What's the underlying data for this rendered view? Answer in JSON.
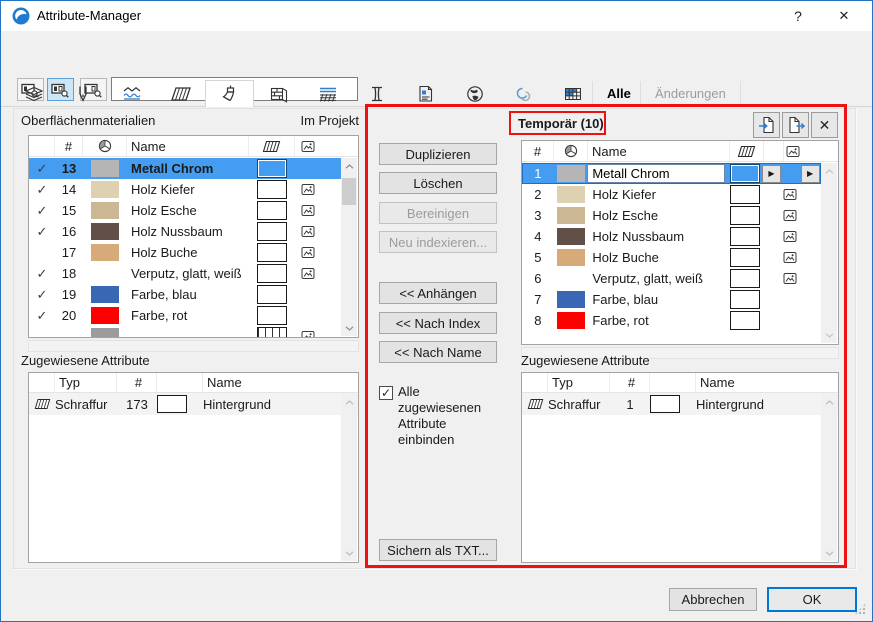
{
  "glyphs": {
    "check": "✓",
    "arrow_right": "▶",
    "close": "✕",
    "help": "?"
  },
  "window": {
    "title": "Attribute-Manager"
  },
  "toolbar": {
    "search_value": ""
  },
  "tab_bar": {
    "alle": "Alle",
    "aenderungen": "Änderungen"
  },
  "headers": {
    "index": "#",
    "name": "Name",
    "type": "Typ"
  },
  "left_panel": {
    "title": "Oberflächenmaterialien",
    "scope": "Im Projekt",
    "rows": [
      {
        "checked": true,
        "index": "13",
        "color": "#b5b5b5",
        "name": "Metall Chrom",
        "has_image": false,
        "selected": true
      },
      {
        "checked": true,
        "index": "14",
        "color": "#ddd1b2",
        "name": "Holz Kiefer",
        "has_image": true,
        "selected": false
      },
      {
        "checked": true,
        "index": "15",
        "color": "#ccb794",
        "name": "Holz Esche",
        "has_image": true,
        "selected": false
      },
      {
        "checked": true,
        "index": "16",
        "color": "#625048",
        "name": "Holz Nussbaum",
        "has_image": true,
        "selected": false
      },
      {
        "checked": false,
        "index": "17",
        "color": "#d7aa79",
        "name": "Holz Buche",
        "has_image": true,
        "selected": false
      },
      {
        "checked": true,
        "index": "18",
        "color": "",
        "name": "Verputz, glatt, weiß",
        "has_image": true,
        "selected": false
      },
      {
        "checked": true,
        "index": "19",
        "color": "#3a67b4",
        "name": "Farbe, blau",
        "has_image": false,
        "selected": false
      },
      {
        "checked": true,
        "index": "20",
        "color": "#fb0200",
        "name": "Farbe, rot",
        "has_image": false,
        "selected": false
      }
    ],
    "partial_row": {
      "color": "#9c9c9c"
    },
    "assigned": {
      "title": "Zugewiesene Attribute",
      "row": {
        "type": "Schraffur",
        "index": "173",
        "name": "Hintergrund"
      }
    }
  },
  "actions": {
    "duplicate": "Duplizieren",
    "delete": "Löschen",
    "purge": "Bereinigen",
    "reindex": "Neu indexieren...",
    "append": "<< Anhängen",
    "by_index": "<< Nach Index",
    "by_name": "<< Nach Name",
    "include_label": "Alle zugewiesenen Attribute einbinden",
    "include_checked": true,
    "save_txt": "Sichern als TXT..."
  },
  "right_panel": {
    "title": "Temporär (10)",
    "rows": [
      {
        "index": "1",
        "color": "#b5b5b5",
        "name": "Metall Chrom",
        "has_image": false,
        "selected": true
      },
      {
        "index": "2",
        "color": "#ddd1b2",
        "name": "Holz Kiefer",
        "has_image": true,
        "selected": false
      },
      {
        "index": "3",
        "color": "#ccb794",
        "name": "Holz Esche",
        "has_image": true,
        "selected": false
      },
      {
        "index": "4",
        "color": "#625048",
        "name": "Holz Nussbaum",
        "has_image": true,
        "selected": false
      },
      {
        "index": "5",
        "color": "#d7aa79",
        "name": "Holz Buche",
        "has_image": true,
        "selected": false
      },
      {
        "index": "6",
        "color": "",
        "name": "Verputz, glatt, weiß",
        "has_image": true,
        "selected": false
      },
      {
        "index": "7",
        "color": "#3a67b4",
        "name": "Farbe, blau",
        "has_image": false,
        "selected": false
      },
      {
        "index": "8",
        "color": "#fb0200",
        "name": "Farbe, rot",
        "has_image": false,
        "selected": false
      }
    ],
    "assigned": {
      "title": "Zugewiesene Attribute",
      "row": {
        "type": "Schraffur",
        "index": "1",
        "name": "Hintergrund"
      }
    }
  },
  "footer": {
    "cancel": "Abbrechen",
    "ok": "OK"
  },
  "colors": {
    "selection": "#459df2",
    "annotation_red": "#ee1111",
    "accent_blue": "#0078d7"
  }
}
